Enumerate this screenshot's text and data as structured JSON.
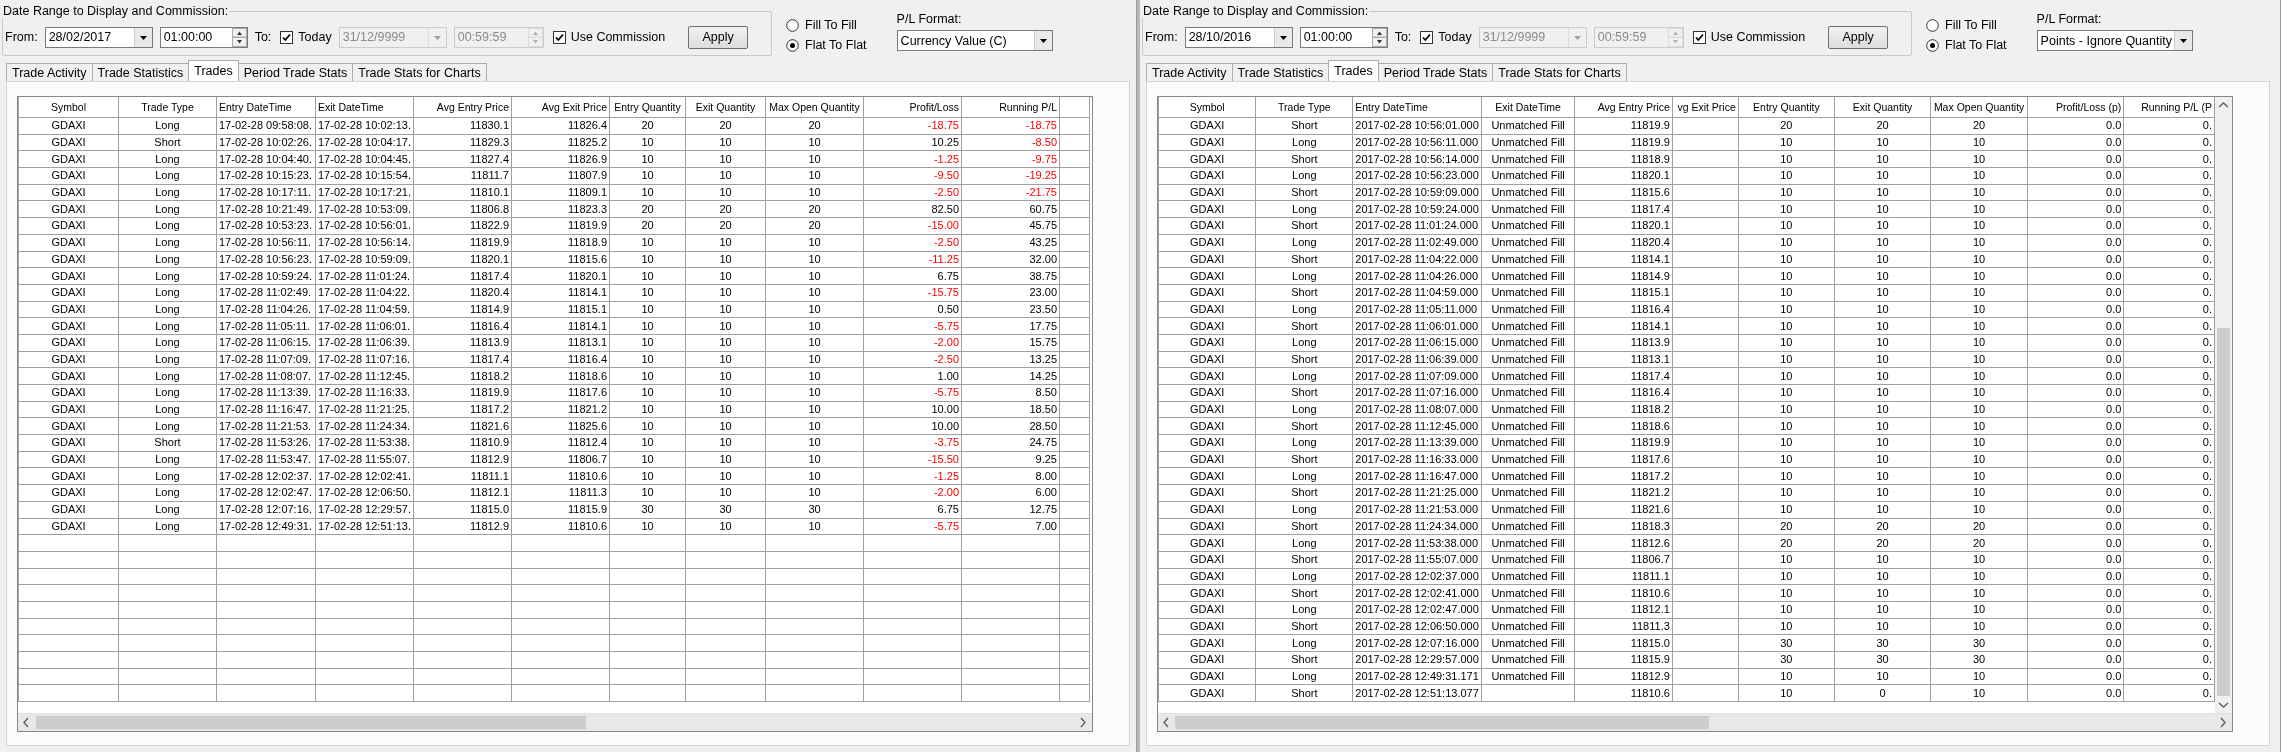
{
  "panels": [
    {
      "range_group": {
        "title": "Date Range to Display and Commission:",
        "from_label": "From:",
        "from_date": "28/02/2017",
        "from_time": "01:00:00",
        "to_label": "To:",
        "today": {
          "label": "Today",
          "checked": true
        },
        "to_date": {
          "value": "31/12/9999",
          "disabled": true
        },
        "to_time": {
          "value": "00:59:59",
          "disabled": true
        },
        "use_commission": {
          "label": "Use Commission",
          "checked": true
        },
        "apply": "Apply"
      },
      "fill_modes": [
        {
          "label": "Fill To Fill",
          "selected": false
        },
        {
          "label": "Flat To Flat",
          "selected": true
        }
      ],
      "pl_format": {
        "label": "P/L Format:",
        "value": "Currency Value (C)"
      },
      "tabs": [
        {
          "label": "Trade Activity",
          "selected": false
        },
        {
          "label": "Trade Statistics",
          "selected": false
        },
        {
          "label": "Trades",
          "selected": true
        },
        {
          "label": "Period Trade Stats",
          "selected": false
        },
        {
          "label": "Trade Stats for Charts",
          "selected": false
        }
      ],
      "table": {
        "columns": [
          "Symbol",
          "Trade Type",
          "Entry DateTime",
          "Exit DateTime",
          "Avg Entry Price",
          "Avg Exit Price",
          "Entry Quantity",
          "Exit Quantity",
          "Max Open Quantity",
          "Profit/Loss",
          "Running P/L"
        ],
        "rows": [
          {
            "cells": [
              "GDAXI",
              "Long",
              "17-02-28 09:58:08.",
              "17-02-28 10:02:13.",
              "11830.1",
              "11826.4",
              "20",
              "20",
              "20",
              "-18.75",
              "-18.75"
            ],
            "loss": true,
            "running_loss": true
          },
          {
            "cells": [
              "GDAXI",
              "Short",
              "17-02-28 10:02:26.",
              "17-02-28 10:04:17.",
              "11829.3",
              "11825.2",
              "10",
              "10",
              "10",
              "10.25",
              "-8.50"
            ],
            "loss": false,
            "running_loss": true
          },
          {
            "cells": [
              "GDAXI",
              "Long",
              "17-02-28 10:04:40.",
              "17-02-28 10:04:45.",
              "11827.4",
              "11826.9",
              "10",
              "10",
              "10",
              "-1.25",
              "-9.75"
            ],
            "loss": true,
            "running_loss": true
          },
          {
            "cells": [
              "GDAXI",
              "Long",
              "17-02-28 10:15:23.",
              "17-02-28 10:15:54.",
              "11811.7",
              "11807.9",
              "10",
              "10",
              "10",
              "-9.50",
              "-19.25"
            ],
            "loss": true,
            "running_loss": true
          },
          {
            "cells": [
              "GDAXI",
              "Long",
              "17-02-28 10:17:11.",
              "17-02-28 10:17:21.",
              "11810.1",
              "11809.1",
              "10",
              "10",
              "10",
              "-2.50",
              "-21.75"
            ],
            "loss": true,
            "running_loss": true
          },
          {
            "cells": [
              "GDAXI",
              "Long",
              "17-02-28 10:21:49.",
              "17-02-28 10:53:09.",
              "11806.8",
              "11823.3",
              "20",
              "20",
              "20",
              "82.50",
              "60.75"
            ],
            "loss": false,
            "running_loss": false
          },
          {
            "cells": [
              "GDAXI",
              "Long",
              "17-02-28 10:53:23.",
              "17-02-28 10:56:01.",
              "11822.9",
              "11819.9",
              "20",
              "20",
              "20",
              "-15.00",
              "45.75"
            ],
            "loss": true,
            "running_loss": false
          },
          {
            "cells": [
              "GDAXI",
              "Long",
              "17-02-28 10:56:11.",
              "17-02-28 10:56:14.",
              "11819.9",
              "11818.9",
              "10",
              "10",
              "10",
              "-2.50",
              "43.25"
            ],
            "loss": true,
            "running_loss": false
          },
          {
            "cells": [
              "GDAXI",
              "Long",
              "17-02-28 10:56:23.",
              "17-02-28 10:59:09.",
              "11820.1",
              "11815.6",
              "10",
              "10",
              "10",
              "-11.25",
              "32.00"
            ],
            "loss": true,
            "running_loss": false
          },
          {
            "cells": [
              "GDAXI",
              "Long",
              "17-02-28 10:59:24.",
              "17-02-28 11:01:24.",
              "11817.4",
              "11820.1",
              "10",
              "10",
              "10",
              "6.75",
              "38.75"
            ],
            "loss": false,
            "running_loss": false
          },
          {
            "cells": [
              "GDAXI",
              "Long",
              "17-02-28 11:02:49.",
              "17-02-28 11:04:22.",
              "11820.4",
              "11814.1",
              "10",
              "10",
              "10",
              "-15.75",
              "23.00"
            ],
            "loss": true,
            "running_loss": false
          },
          {
            "cells": [
              "GDAXI",
              "Long",
              "17-02-28 11:04:26.",
              "17-02-28 11:04:59.",
              "11814.9",
              "11815.1",
              "10",
              "10",
              "10",
              "0.50",
              "23.50"
            ],
            "loss": false,
            "running_loss": false
          },
          {
            "cells": [
              "GDAXI",
              "Long",
              "17-02-28 11:05:11.",
              "17-02-28 11:06:01.",
              "11816.4",
              "11814.1",
              "10",
              "10",
              "10",
              "-5.75",
              "17.75"
            ],
            "loss": true,
            "running_loss": false
          },
          {
            "cells": [
              "GDAXI",
              "Long",
              "17-02-28 11:06:15.",
              "17-02-28 11:06:39.",
              "11813.9",
              "11813.1",
              "10",
              "10",
              "10",
              "-2.00",
              "15.75"
            ],
            "loss": true,
            "running_loss": false
          },
          {
            "cells": [
              "GDAXI",
              "Long",
              "17-02-28 11:07:09.",
              "17-02-28 11:07:16.",
              "11817.4",
              "11816.4",
              "10",
              "10",
              "10",
              "-2.50",
              "13.25"
            ],
            "loss": true,
            "running_loss": false
          },
          {
            "cells": [
              "GDAXI",
              "Long",
              "17-02-28 11:08:07.",
              "17-02-28 11:12:45.",
              "11818.2",
              "11818.6",
              "10",
              "10",
              "10",
              "1.00",
              "14.25"
            ],
            "loss": false,
            "running_loss": false
          },
          {
            "cells": [
              "GDAXI",
              "Long",
              "17-02-28 11:13:39.",
              "17-02-28 11:16:33.",
              "11819.9",
              "11817.6",
              "10",
              "10",
              "10",
              "-5.75",
              "8.50"
            ],
            "loss": true,
            "running_loss": false
          },
          {
            "cells": [
              "GDAXI",
              "Long",
              "17-02-28 11:16:47.",
              "17-02-28 11:21:25.",
              "11817.2",
              "11821.2",
              "10",
              "10",
              "10",
              "10.00",
              "18.50"
            ],
            "loss": false,
            "running_loss": false
          },
          {
            "cells": [
              "GDAXI",
              "Long",
              "17-02-28 11:21:53.",
              "17-02-28 11:24:34.",
              "11821.6",
              "11825.6",
              "10",
              "10",
              "10",
              "10.00",
              "28.50"
            ],
            "loss": false,
            "running_loss": false
          },
          {
            "cells": [
              "GDAXI",
              "Short",
              "17-02-28 11:53:26.",
              "17-02-28 11:53:38.",
              "11810.9",
              "11812.4",
              "10",
              "10",
              "10",
              "-3.75",
              "24.75"
            ],
            "loss": true,
            "running_loss": false
          },
          {
            "cells": [
              "GDAXI",
              "Long",
              "17-02-28 11:53:47.",
              "17-02-28 11:55:07.",
              "11812.9",
              "11806.7",
              "10",
              "10",
              "10",
              "-15.50",
              "9.25"
            ],
            "loss": true,
            "running_loss": false
          },
          {
            "cells": [
              "GDAXI",
              "Long",
              "17-02-28 12:02:37.",
              "17-02-28 12:02:41.",
              "11811.1",
              "11810.6",
              "10",
              "10",
              "10",
              "-1.25",
              "8.00"
            ],
            "loss": true,
            "running_loss": false
          },
          {
            "cells": [
              "GDAXI",
              "Long",
              "17-02-28 12:02:47.",
              "17-02-28 12:06:50.",
              "11812.1",
              "11811.3",
              "10",
              "10",
              "10",
              "-2.00",
              "6.00"
            ],
            "loss": true,
            "running_loss": false
          },
          {
            "cells": [
              "GDAXI",
              "Long",
              "17-02-28 12:07:16.",
              "17-02-28 12:29:57.",
              "11815.0",
              "11815.9",
              "30",
              "30",
              "30",
              "6.75",
              "12.75"
            ],
            "loss": false,
            "running_loss": false
          },
          {
            "cells": [
              "GDAXI",
              "Long",
              "17-02-28 12:49:31.",
              "17-02-28 12:51:13.",
              "11812.9",
              "11810.6",
              "10",
              "10",
              "10",
              "-5.75",
              "7.00"
            ],
            "loss": true,
            "running_loss": false
          }
        ]
      }
    },
    {
      "range_group": {
        "title": "Date Range to Display and Commission:",
        "from_label": "From:",
        "from_date": "28/10/2016",
        "from_time": "01:00:00",
        "to_label": "To:",
        "today": {
          "label": "Today",
          "checked": true
        },
        "to_date": {
          "value": "31/12/9999",
          "disabled": true
        },
        "to_time": {
          "value": "00:59:59",
          "disabled": true
        },
        "use_commission": {
          "label": "Use Commission",
          "checked": true
        },
        "apply": "Apply"
      },
      "fill_modes": [
        {
          "label": "Fill To Fill",
          "selected": false
        },
        {
          "label": "Flat To Flat",
          "selected": true
        }
      ],
      "pl_format": {
        "label": "P/L Format:",
        "value": "Points - Ignore Quantity"
      },
      "tabs": [
        {
          "label": "Trade Activity",
          "selected": false
        },
        {
          "label": "Trade Statistics",
          "selected": false
        },
        {
          "label": "Trades",
          "selected": true
        },
        {
          "label": "Period Trade Stats",
          "selected": false
        },
        {
          "label": "Trade Stats for Charts",
          "selected": false
        }
      ],
      "table": {
        "columns": [
          "Symbol",
          "Trade Type",
          "Entry DateTime",
          "Exit DateTime",
          "Avg Entry Price",
          "vg Exit Price",
          "Entry Quantity",
          "Exit Quantity",
          "Max Open Quantity",
          "Profit/Loss (p)",
          "Running P/L (P"
        ],
        "rows": [
          {
            "cells": [
              "GDAXI",
              "Short",
              "2017-02-28 10:56:01.000",
              "Unmatched Fill",
              "11819.9",
              null,
              "20",
              "20",
              "20",
              "0.0",
              "0."
            ]
          },
          {
            "cells": [
              "GDAXI",
              "Long",
              "2017-02-28 10:56:11.000",
              "Unmatched Fill",
              "11819.9",
              null,
              "10",
              "10",
              "10",
              "0.0",
              "0."
            ]
          },
          {
            "cells": [
              "GDAXI",
              "Short",
              "2017-02-28 10:56:14.000",
              "Unmatched Fill",
              "11818.9",
              null,
              "10",
              "10",
              "10",
              "0.0",
              "0."
            ]
          },
          {
            "cells": [
              "GDAXI",
              "Long",
              "2017-02-28 10:56:23.000",
              "Unmatched Fill",
              "11820.1",
              null,
              "10",
              "10",
              "10",
              "0.0",
              "0."
            ]
          },
          {
            "cells": [
              "GDAXI",
              "Short",
              "2017-02-28 10:59:09.000",
              "Unmatched Fill",
              "11815.6",
              null,
              "10",
              "10",
              "10",
              "0.0",
              "0."
            ]
          },
          {
            "cells": [
              "GDAXI",
              "Long",
              "2017-02-28 10:59:24.000",
              "Unmatched Fill",
              "11817.4",
              null,
              "10",
              "10",
              "10",
              "0.0",
              "0."
            ]
          },
          {
            "cells": [
              "GDAXI",
              "Short",
              "2017-02-28 11:01:24.000",
              "Unmatched Fill",
              "11820.1",
              null,
              "10",
              "10",
              "10",
              "0.0",
              "0."
            ]
          },
          {
            "cells": [
              "GDAXI",
              "Long",
              "2017-02-28 11:02:49.000",
              "Unmatched Fill",
              "11820.4",
              null,
              "10",
              "10",
              "10",
              "0.0",
              "0."
            ]
          },
          {
            "cells": [
              "GDAXI",
              "Short",
              "2017-02-28 11:04:22.000",
              "Unmatched Fill",
              "11814.1",
              null,
              "10",
              "10",
              "10",
              "0.0",
              "0."
            ]
          },
          {
            "cells": [
              "GDAXI",
              "Long",
              "2017-02-28 11:04:26.000",
              "Unmatched Fill",
              "11814.9",
              null,
              "10",
              "10",
              "10",
              "0.0",
              "0."
            ]
          },
          {
            "cells": [
              "GDAXI",
              "Short",
              "2017-02-28 11:04:59.000",
              "Unmatched Fill",
              "11815.1",
              null,
              "10",
              "10",
              "10",
              "0.0",
              "0."
            ]
          },
          {
            "cells": [
              "GDAXI",
              "Long",
              "2017-02-28 11:05:11.000",
              "Unmatched Fill",
              "11816.4",
              null,
              "10",
              "10",
              "10",
              "0.0",
              "0."
            ]
          },
          {
            "cells": [
              "GDAXI",
              "Short",
              "2017-02-28 11:06:01.000",
              "Unmatched Fill",
              "11814.1",
              null,
              "10",
              "10",
              "10",
              "0.0",
              "0."
            ]
          },
          {
            "cells": [
              "GDAXI",
              "Long",
              "2017-02-28 11:06:15.000",
              "Unmatched Fill",
              "11813.9",
              null,
              "10",
              "10",
              "10",
              "0.0",
              "0."
            ]
          },
          {
            "cells": [
              "GDAXI",
              "Short",
              "2017-02-28 11:06:39.000",
              "Unmatched Fill",
              "11813.1",
              null,
              "10",
              "10",
              "10",
              "0.0",
              "0."
            ]
          },
          {
            "cells": [
              "GDAXI",
              "Long",
              "2017-02-28 11:07:09.000",
              "Unmatched Fill",
              "11817.4",
              null,
              "10",
              "10",
              "10",
              "0.0",
              "0."
            ]
          },
          {
            "cells": [
              "GDAXI",
              "Short",
              "2017-02-28 11:07:16.000",
              "Unmatched Fill",
              "11816.4",
              null,
              "10",
              "10",
              "10",
              "0.0",
              "0."
            ]
          },
          {
            "cells": [
              "GDAXI",
              "Long",
              "2017-02-28 11:08:07.000",
              "Unmatched Fill",
              "11818.2",
              null,
              "10",
              "10",
              "10",
              "0.0",
              "0."
            ]
          },
          {
            "cells": [
              "GDAXI",
              "Short",
              "2017-02-28 11:12:45.000",
              "Unmatched Fill",
              "11818.6",
              null,
              "10",
              "10",
              "10",
              "0.0",
              "0."
            ]
          },
          {
            "cells": [
              "GDAXI",
              "Long",
              "2017-02-28 11:13:39.000",
              "Unmatched Fill",
              "11819.9",
              null,
              "10",
              "10",
              "10",
              "0.0",
              "0."
            ]
          },
          {
            "cells": [
              "GDAXI",
              "Short",
              "2017-02-28 11:16:33.000",
              "Unmatched Fill",
              "11817.6",
              null,
              "10",
              "10",
              "10",
              "0.0",
              "0."
            ]
          },
          {
            "cells": [
              "GDAXI",
              "Long",
              "2017-02-28 11:16:47.000",
              "Unmatched Fill",
              "11817.2",
              null,
              "10",
              "10",
              "10",
              "0.0",
              "0."
            ]
          },
          {
            "cells": [
              "GDAXI",
              "Short",
              "2017-02-28 11:21:25.000",
              "Unmatched Fill",
              "11821.2",
              null,
              "10",
              "10",
              "10",
              "0.0",
              "0."
            ]
          },
          {
            "cells": [
              "GDAXI",
              "Long",
              "2017-02-28 11:21:53.000",
              "Unmatched Fill",
              "11821.6",
              null,
              "10",
              "10",
              "10",
              "0.0",
              "0."
            ]
          },
          {
            "cells": [
              "GDAXI",
              "Short",
              "2017-02-28 11:24:34.000",
              "Unmatched Fill",
              "11818.3",
              null,
              "20",
              "20",
              "20",
              "0.0",
              "0."
            ]
          },
          {
            "cells": [
              "GDAXI",
              "Long",
              "2017-02-28 11:53:38.000",
              "Unmatched Fill",
              "11812.6",
              null,
              "20",
              "20",
              "20",
              "0.0",
              "0."
            ]
          },
          {
            "cells": [
              "GDAXI",
              "Short",
              "2017-02-28 11:55:07.000",
              "Unmatched Fill",
              "11806.7",
              null,
              "10",
              "10",
              "10",
              "0.0",
              "0."
            ]
          },
          {
            "cells": [
              "GDAXI",
              "Long",
              "2017-02-28 12:02:37.000",
              "Unmatched Fill",
              "11811.1",
              null,
              "10",
              "10",
              "10",
              "0.0",
              "0."
            ]
          },
          {
            "cells": [
              "GDAXI",
              "Short",
              "2017-02-28 12:02:41.000",
              "Unmatched Fill",
              "11810.6",
              null,
              "10",
              "10",
              "10",
              "0.0",
              "0."
            ]
          },
          {
            "cells": [
              "GDAXI",
              "Long",
              "2017-02-28 12:02:47.000",
              "Unmatched Fill",
              "11812.1",
              null,
              "10",
              "10",
              "10",
              "0.0",
              "0."
            ]
          },
          {
            "cells": [
              "GDAXI",
              "Short",
              "2017-02-28 12:06:50.000",
              "Unmatched Fill",
              "11811.3",
              null,
              "10",
              "10",
              "10",
              "0.0",
              "0."
            ]
          },
          {
            "cells": [
              "GDAXI",
              "Long",
              "2017-02-28 12:07:16.000",
              "Unmatched Fill",
              "11815.0",
              null,
              "30",
              "30",
              "30",
              "0.0",
              "0."
            ]
          },
          {
            "cells": [
              "GDAXI",
              "Short",
              "2017-02-28 12:29:57.000",
              "Unmatched Fill",
              "11815.9",
              null,
              "30",
              "30",
              "30",
              "0.0",
              "0."
            ]
          },
          {
            "cells": [
              "GDAXI",
              "Long",
              "2017-02-28 12:49:31.171",
              "Unmatched Fill",
              "11812.9",
              null,
              "10",
              "10",
              "10",
              "0.0",
              "0."
            ]
          },
          {
            "cells": [
              "GDAXI",
              "Short",
              "2017-02-28 12:51:13.077",
              null,
              "11810.6",
              null,
              "10",
              "0",
              "10",
              "0.0",
              "0."
            ]
          }
        ]
      }
    }
  ]
}
